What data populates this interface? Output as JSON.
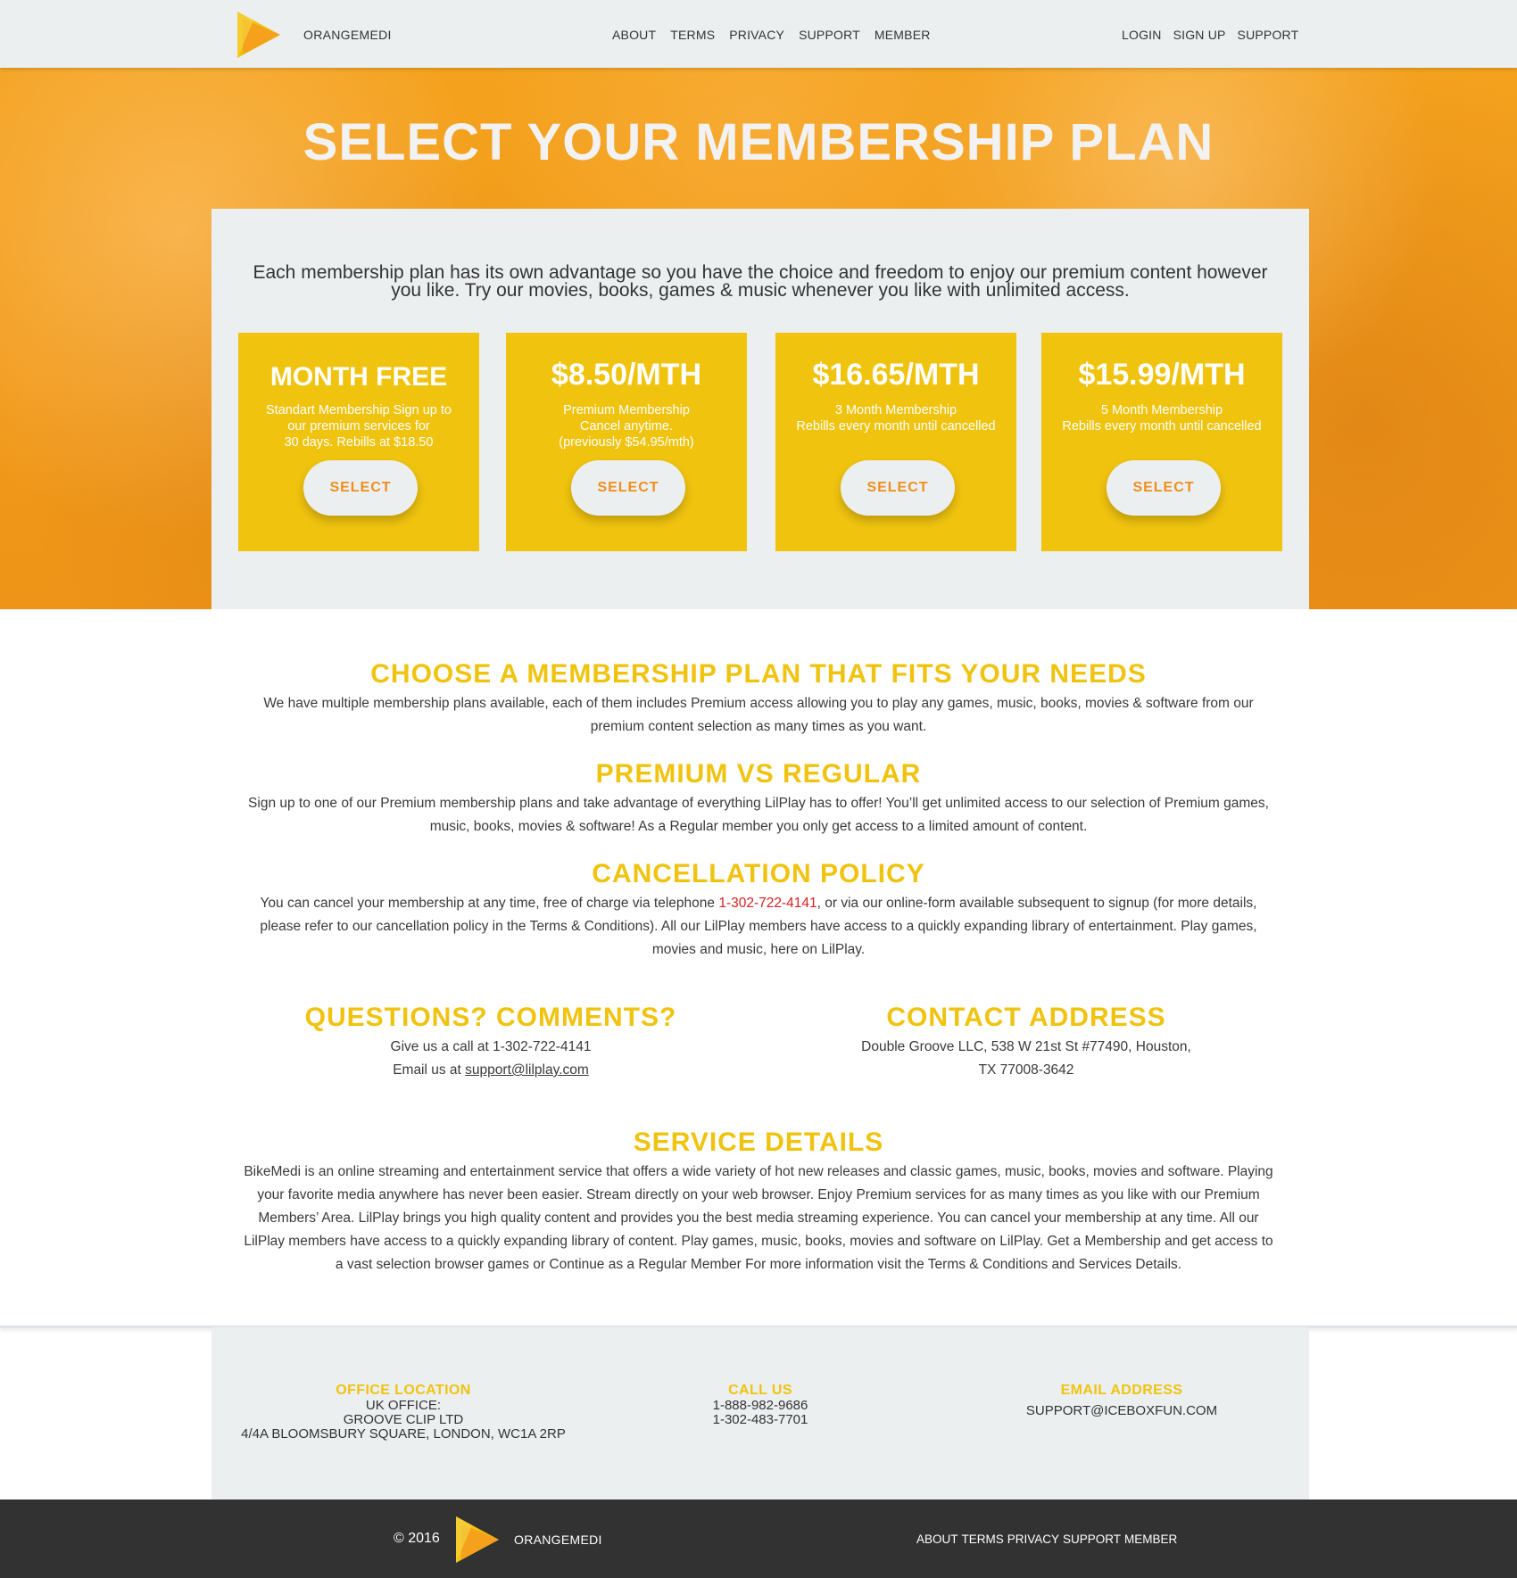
{
  "header": {
    "brand": "ORANGEMEDI",
    "nav_center": [
      "ABOUT",
      "TERMS",
      "PRIVACY",
      "SUPPORT",
      "MEMBER"
    ],
    "nav_right": [
      "LOGIN",
      "SIGN UP",
      "SUPPORT"
    ]
  },
  "hero": {
    "title": "SELECT YOUR MEMBERSHIP PLAN",
    "intro": "Each membership plan has its own advantage so you have the choice and freedom to enjoy our premium content however you like. Try our movies, books, games & music whenever you like with unlimited access.",
    "plans": [
      {
        "price": "MONTH FREE",
        "desc": "Standart Membership Sign up to\nour premium services for\n30 days. Rebills at $18.50",
        "button": "SELECT"
      },
      {
        "price": "$8.50/MTH",
        "desc": "Premium Membership\nCancel anytime.\n(previously $54.95/mth)",
        "button": "SELECT"
      },
      {
        "price": "$16.65/MTH",
        "desc": "3 Month Membership\nRebills every month until cancelled",
        "button": "SELECT"
      },
      {
        "price": "$15.99/MTH",
        "desc": "5 Month Membership\nRebills every month until cancelled",
        "button": "SELECT"
      }
    ]
  },
  "sections": {
    "choose": {
      "title": "CHOOSE A MEMBERSHIP PLAN THAT FITS YOUR NEEDS",
      "body": "We have multiple membership plans available, each of them includes Premium access allowing you to play any games, music, books, movies & software from our premium content selection as many times as you want."
    },
    "premium": {
      "title": "PREMIUM VS REGULAR",
      "body": "Sign up to one of our Premium membership plans and take advantage of everything LilPlay has to offer! You’ll get unlimited access to our selection of Premium games, music, books, movies & software! As a Regular member you only get access to a limited amount of content."
    },
    "cancel": {
      "title": "CANCELLATION POLICY",
      "body_before": "You can cancel your membership at any time, free of charge via telephone ",
      "phone": "1-302-722-4141",
      "body_after": ", or via our online-form available subsequent to signup (for more details, please refer to our cancellation policy in the Terms & Conditions). All our LilPlay members have access to a quickly expanding library of entertainment. Play games, movies and music, here on LilPlay."
    },
    "questions": {
      "title": "QUESTIONS? COMMENTS?",
      "call_line": "Give us a call at 1-302-722-4141",
      "email_prefix": "Email us at ",
      "email": "support@lilplay.com"
    },
    "address": {
      "title": "CONTACT ADDRESS",
      "line1": "Double Groove LLC, 538 W 21st St #77490, Houston,",
      "line2": "TX 77008-3642"
    },
    "service": {
      "title": "SERVICE DETAILS",
      "body": "BikeMedi is an online streaming and entertainment service that offers a wide variety of hot new releases and classic games, music, books, movies and software. Playing your favorite media anywhere has never been easier. Stream directly on your web browser. Enjoy Premium services for as many times as you like with our Premium Members’ Area. LilPlay brings you high quality content and provides you the best media streaming experience. You can cancel your membership at any time. All our LilPlay members have access to a quickly expanding library of content. Play games, music, books, movies and software on LilPlay. Get a Membership and get access to a vast selection browser games or Continue as a Regular Member For more information visit the Terms & Conditions and Services Details."
    }
  },
  "footer_info": {
    "office": {
      "title": "OFFICE LOCATION",
      "lines": [
        "UK OFFICE:",
        "GROOVE CLIP LTD",
        "4/4A BLOOMSBURY SQUARE, LONDON, WC1A 2RP"
      ]
    },
    "call": {
      "title": "CALL US",
      "lines": [
        "1-888-982-9686",
        "1-302-483-7701"
      ]
    },
    "email": {
      "title": "EMAIL ADDRESS",
      "lines": [
        "SUPPORT@ICEBOXFUN.COM"
      ]
    }
  },
  "bottom_bar": {
    "copyright": "© 2016",
    "brand": "ORANGEMEDI",
    "nav": [
      "ABOUT",
      "TERMS",
      "PRIVACY",
      "SUPPORT",
      "MEMBER"
    ]
  },
  "colors": {
    "accent_yellow": "#f0c30f",
    "hero_orange": "#f19a1a",
    "button_text": "#ee8f1d",
    "panel_gray": "#eceff0",
    "bottom_bar": "#323232",
    "phone_red": "#d62020"
  }
}
